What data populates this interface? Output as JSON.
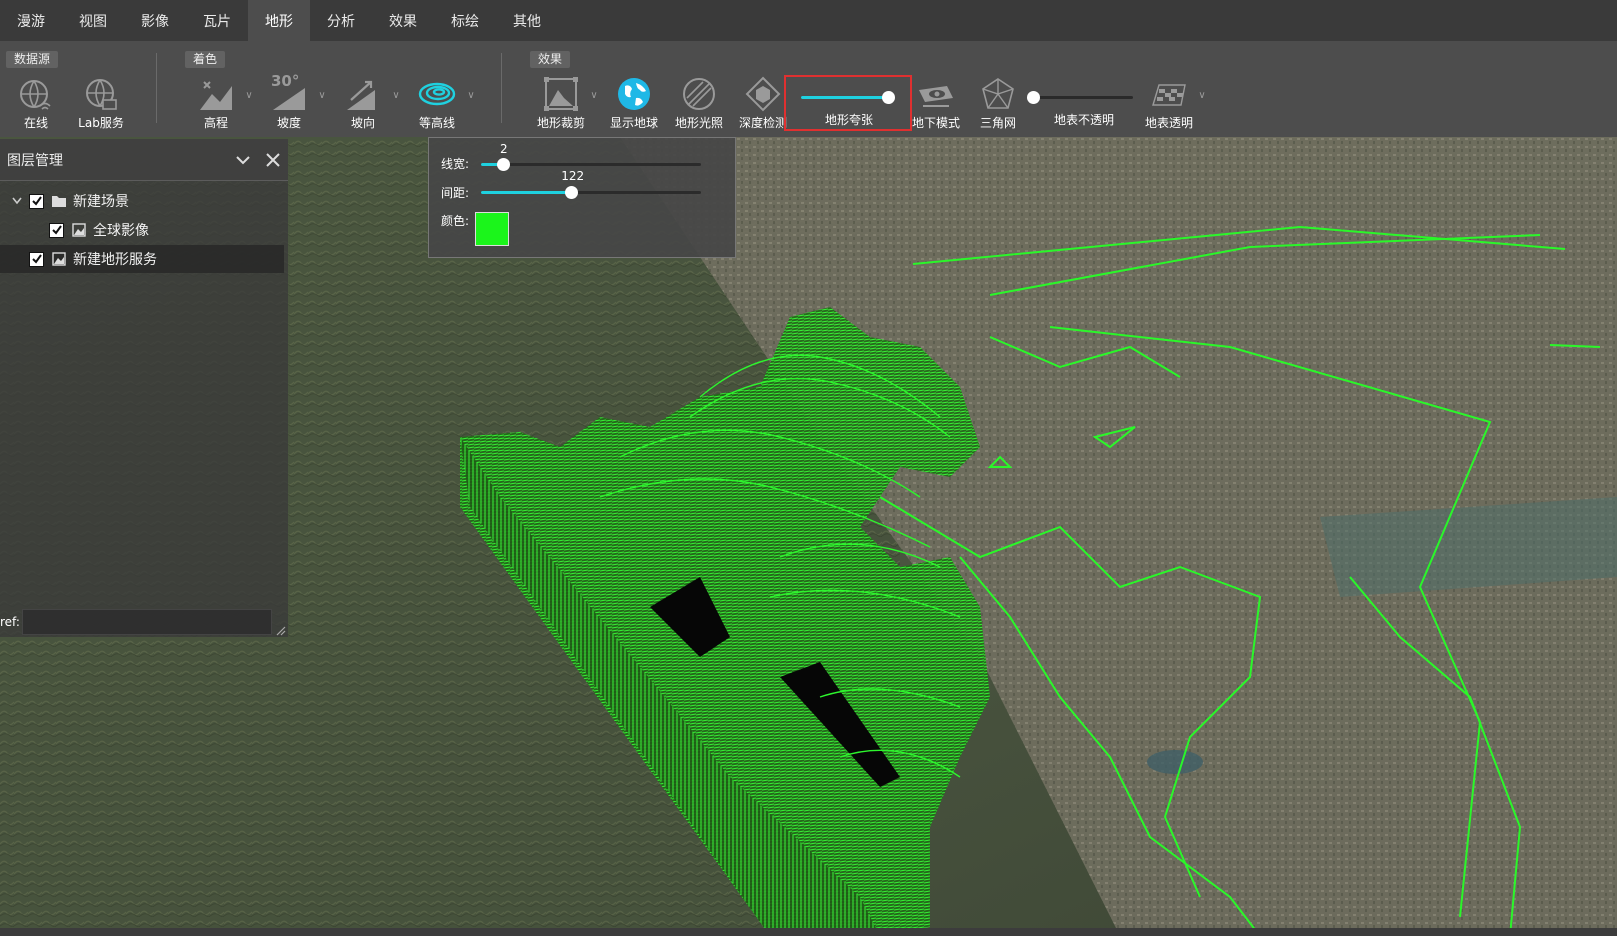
{
  "menu": {
    "items": [
      "漫游",
      "视图",
      "影像",
      "瓦片",
      "地形",
      "分析",
      "效果",
      "标绘",
      "其他"
    ],
    "active_index": 4
  },
  "ribbon": {
    "groups": {
      "datasource": "数据源",
      "coloring": "着色",
      "effects": "效果"
    },
    "tools": {
      "online": "在线",
      "lab_service": "Lab服务",
      "elevation": "高程",
      "slope": "坡度",
      "aspect": "坡向",
      "contour": "等高线",
      "terrain_clip": "地形裁剪",
      "show_globe": "显示地球",
      "terrain_lighting": "地形光照",
      "depth_test": "深度检测",
      "terrain_exaggeration": "地形夸张",
      "underground_mode": "地下模式",
      "triangle_mesh": "三角网",
      "surface_opacity": "地表不透明",
      "surface_transparent": "地表透明"
    },
    "slope_icon_text": "30°",
    "exaggeration_level": 0.95,
    "opacity_level": 0.0
  },
  "layer_panel": {
    "title": "图层管理",
    "tree": [
      {
        "label": "新建场景",
        "checked": true,
        "type": "folder",
        "expanded": true
      },
      {
        "label": "全球影像",
        "checked": true,
        "type": "image"
      },
      {
        "label": "新建地形服务",
        "checked": true,
        "type": "image",
        "selected": true
      }
    ],
    "ref_label": "ref:",
    "ref_value": ""
  },
  "contour_popup": {
    "line_width_label": "线宽:",
    "line_width_value": "2",
    "line_width_level": 0.1,
    "spacing_label": "间距:",
    "spacing_value": "122",
    "spacing_level": 0.41,
    "color_label": "颜色:",
    "color": "#1bf51b"
  },
  "colors": {
    "accent": "#1fd1e0",
    "highlight_border": "#e03030",
    "contour": "#2df52d"
  }
}
